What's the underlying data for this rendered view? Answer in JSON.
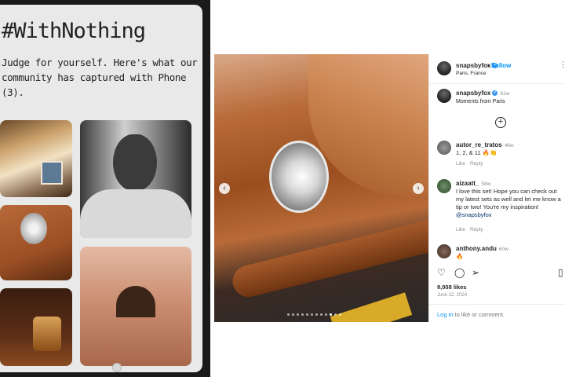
{
  "phone": {
    "hashtag": "#WithNothing",
    "tagline": "Judge for yourself. Here's what our community has captured with Phone (3)."
  },
  "post": {
    "header": {
      "username": "snapsbyfox",
      "follow_label": "Follow",
      "separator": "•",
      "location": "Paris, France",
      "more_label": "⋮"
    },
    "caption": {
      "username": "snapsbyfox",
      "age": "61w",
      "text": "Moments from Paris"
    },
    "load_more_label": "+",
    "comments": [
      {
        "username": "autor_re_tratos",
        "age": "46w",
        "text": "1, 2, & 11 🔥👏",
        "like_label": "Like",
        "reply_label": "Reply"
      },
      {
        "username": "aizaatt_",
        "age": "58w",
        "text": "I love this set! Hope you can check out my latest sets as well and let me know a tip or two! You're my inspiration! ",
        "mention": "@snapsbyfox",
        "like_label": "Like",
        "reply_label": "Reply"
      },
      {
        "username": "anthony.andu",
        "age": "60w",
        "text": "🔥"
      }
    ],
    "likes": "9,008 likes",
    "date": "June 22, 2024",
    "login_link": "Log in",
    "login_rest": " to like or comment.",
    "icons": {
      "like": "heart-icon",
      "comment": "comment-icon",
      "share": "share-icon",
      "save": "bookmark-icon"
    },
    "carousel": {
      "prev": "‹",
      "next": "›",
      "slide_count": 12,
      "active_slide": 9
    }
  },
  "colors": {
    "link": "#0095f6",
    "verified": "#3897f0",
    "text": "#262626",
    "muted": "#8e8e8e"
  }
}
